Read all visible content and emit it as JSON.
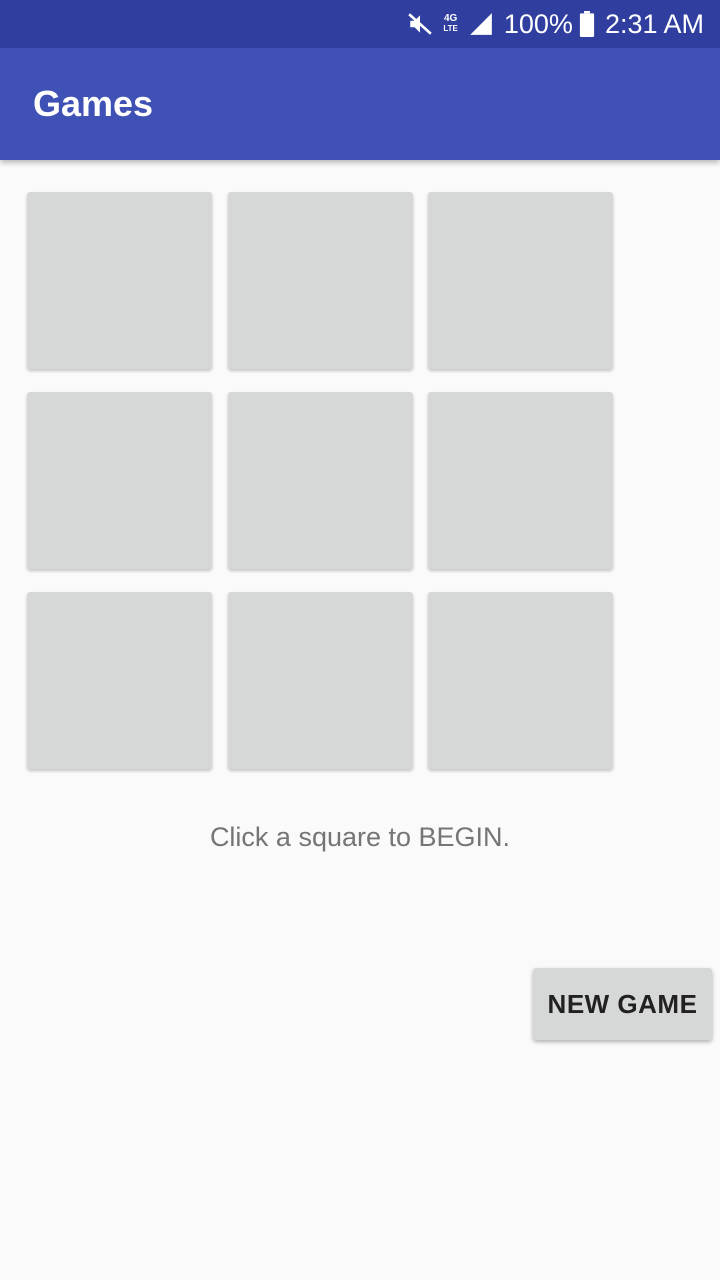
{
  "status_bar": {
    "icons": [
      "mute-icon",
      "network-4g-lte-icon",
      "signal-icon",
      "battery-icon"
    ],
    "network_label_top": "4G",
    "network_label_bottom": "LTE",
    "battery": "100%",
    "time": "2:31 AM"
  },
  "app_bar": {
    "title": "Games"
  },
  "board": {
    "cells": [
      "",
      "",
      "",
      "",
      "",
      "",
      "",
      "",
      ""
    ]
  },
  "message": "Click a square to BEGIN.",
  "new_game_label": "NEW GAME",
  "colors": {
    "status_bar": "#303f9f",
    "app_bar": "#3f51b5",
    "cell": "#d6d7d7",
    "background": "#fafafa"
  }
}
